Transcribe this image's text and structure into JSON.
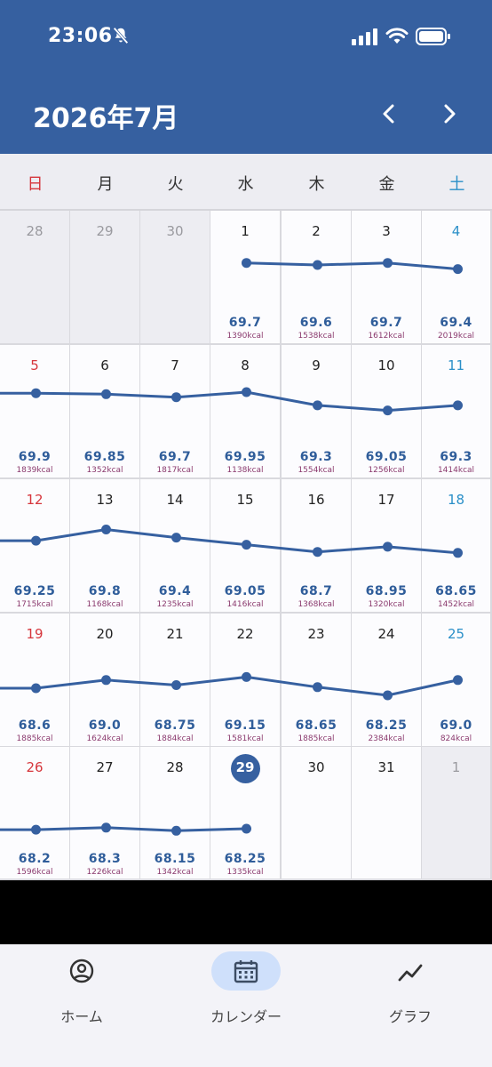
{
  "status": {
    "time": "23:06"
  },
  "header": {
    "title": "2026年7月"
  },
  "weekdays": [
    "日",
    "月",
    "火",
    "水",
    "木",
    "金",
    "土"
  ],
  "days": [
    {
      "day": "28",
      "other": true,
      "weight": "",
      "kcal": ""
    },
    {
      "day": "29",
      "other": true,
      "weight": "",
      "kcal": ""
    },
    {
      "day": "30",
      "other": true,
      "weight": "",
      "kcal": ""
    },
    {
      "day": "1",
      "weight": "69.7",
      "kcal": "1390kcal"
    },
    {
      "day": "2",
      "weight": "69.6",
      "kcal": "1538kcal"
    },
    {
      "day": "3",
      "weight": "69.7",
      "kcal": "1612kcal"
    },
    {
      "day": "4",
      "weight": "69.4",
      "kcal": "2019kcal"
    },
    {
      "day": "5",
      "weight": "69.9",
      "kcal": "1839kcal"
    },
    {
      "day": "6",
      "weight": "69.85",
      "kcal": "1352kcal"
    },
    {
      "day": "7",
      "weight": "69.7",
      "kcal": "1817kcal"
    },
    {
      "day": "8",
      "weight": "69.95",
      "kcal": "1138kcal"
    },
    {
      "day": "9",
      "weight": "69.3",
      "kcal": "1554kcal"
    },
    {
      "day": "10",
      "weight": "69.05",
      "kcal": "1256kcal"
    },
    {
      "day": "11",
      "weight": "69.3",
      "kcal": "1414kcal"
    },
    {
      "day": "12",
      "weight": "69.25",
      "kcal": "1715kcal"
    },
    {
      "day": "13",
      "weight": "69.8",
      "kcal": "1168kcal"
    },
    {
      "day": "14",
      "weight": "69.4",
      "kcal": "1235kcal"
    },
    {
      "day": "15",
      "weight": "69.05",
      "kcal": "1416kcal"
    },
    {
      "day": "16",
      "weight": "68.7",
      "kcal": "1368kcal"
    },
    {
      "day": "17",
      "weight": "68.95",
      "kcal": "1320kcal"
    },
    {
      "day": "18",
      "weight": "68.65",
      "kcal": "1452kcal"
    },
    {
      "day": "19",
      "weight": "68.6",
      "kcal": "1885kcal"
    },
    {
      "day": "20",
      "weight": "69.0",
      "kcal": "1624kcal"
    },
    {
      "day": "21",
      "weight": "68.75",
      "kcal": "1884kcal"
    },
    {
      "day": "22",
      "weight": "69.15",
      "kcal": "1581kcal"
    },
    {
      "day": "23",
      "weight": "68.65",
      "kcal": "1885kcal"
    },
    {
      "day": "24",
      "weight": "68.25",
      "kcal": "2384kcal"
    },
    {
      "day": "25",
      "weight": "69.0",
      "kcal": "824kcal"
    },
    {
      "day": "26",
      "weight": "68.2",
      "kcal": "1596kcal"
    },
    {
      "day": "27",
      "weight": "68.3",
      "kcal": "1226kcal"
    },
    {
      "day": "28",
      "weight": "68.15",
      "kcal": "1342kcal"
    },
    {
      "day": "29",
      "weight": "68.25",
      "kcal": "1335kcal",
      "today": true
    },
    {
      "day": "30",
      "weight": "",
      "kcal": ""
    },
    {
      "day": "31",
      "weight": "",
      "kcal": ""
    },
    {
      "day": "1",
      "other": true,
      "weight": "",
      "kcal": ""
    }
  ],
  "tabs": [
    {
      "label": "ホーム",
      "icon": "home-icon"
    },
    {
      "label": "カレンダー",
      "icon": "calendar-icon",
      "active": true
    },
    {
      "label": "グラフ",
      "icon": "graph-icon"
    }
  ],
  "colors": {
    "primary": "#3660a0",
    "sunday": "#d6363c",
    "saturday": "#2a8fc8",
    "weight": "#2f5d9a",
    "kcal": "#8b3a6e"
  }
}
